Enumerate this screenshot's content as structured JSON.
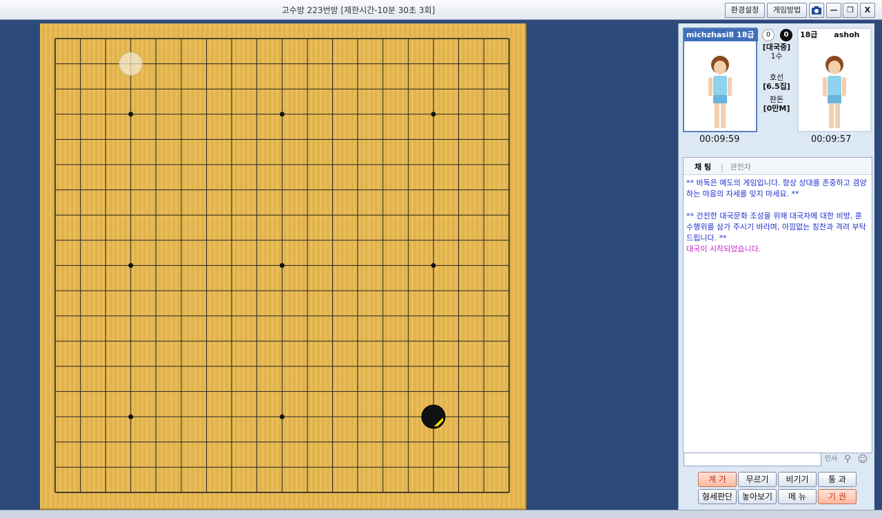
{
  "window": {
    "title": "고수방 223번방 [제한시간-10분 30초 3회]",
    "buttons": {
      "settings": "환경설정",
      "howto": "게임방법",
      "minimize": "—",
      "restore": "❐",
      "close": "X"
    }
  },
  "board": {
    "size": 19,
    "star_points": [
      [
        3,
        3
      ],
      [
        3,
        9
      ],
      [
        3,
        15
      ],
      [
        9,
        3
      ],
      [
        9,
        9
      ],
      [
        9,
        15
      ],
      [
        15,
        3
      ],
      [
        15,
        9
      ],
      [
        15,
        15
      ]
    ],
    "stones": [
      {
        "row": 1,
        "col": 3,
        "color": "white",
        "faded": true
      },
      {
        "row": 15,
        "col": 15,
        "color": "black",
        "last_move": true
      }
    ]
  },
  "players": {
    "left": {
      "name": "michzhasi8 18급",
      "time": "00:09:59",
      "captures": "0"
    },
    "right": {
      "rank": "18급",
      "name": "ashoh",
      "time": "00:09:57",
      "captures": "0"
    }
  },
  "game_info": {
    "status": "[대국중]",
    "moves": "1수",
    "handicap_label": "호선",
    "komi": "[6.5집]",
    "stake_label": "판돈",
    "stake": "[0만M]"
  },
  "chat": {
    "tab_chat": "채 팅",
    "tab_sep": "|",
    "tab_observers": "관전자",
    "messages": [
      {
        "text": "** 바둑은 예도의 게임입니다. 항상 상대를 존중하고 겸양하는 마음의 자세를 잊지 마세요. **",
        "color": "blue"
      },
      {
        "text": "** 건전한 대국문화 조성을 위해 대국자에 대한 비방, 훈수행위를 삼가 주시기 바라며, 아낌없는 칭찬과 격려 부탁드립니다.  **",
        "color": "blue"
      },
      {
        "text": "대국이 시작되었습니다.",
        "color": "magenta"
      }
    ],
    "greet_label": "인사"
  },
  "actions": {
    "count": "계 가",
    "undo": "무르기",
    "draw": "비기기",
    "pass": "통 과",
    "evaluate": "형세판단",
    "placement": "놓아보기",
    "menu": "메 뉴",
    "resign": "기 권"
  }
}
